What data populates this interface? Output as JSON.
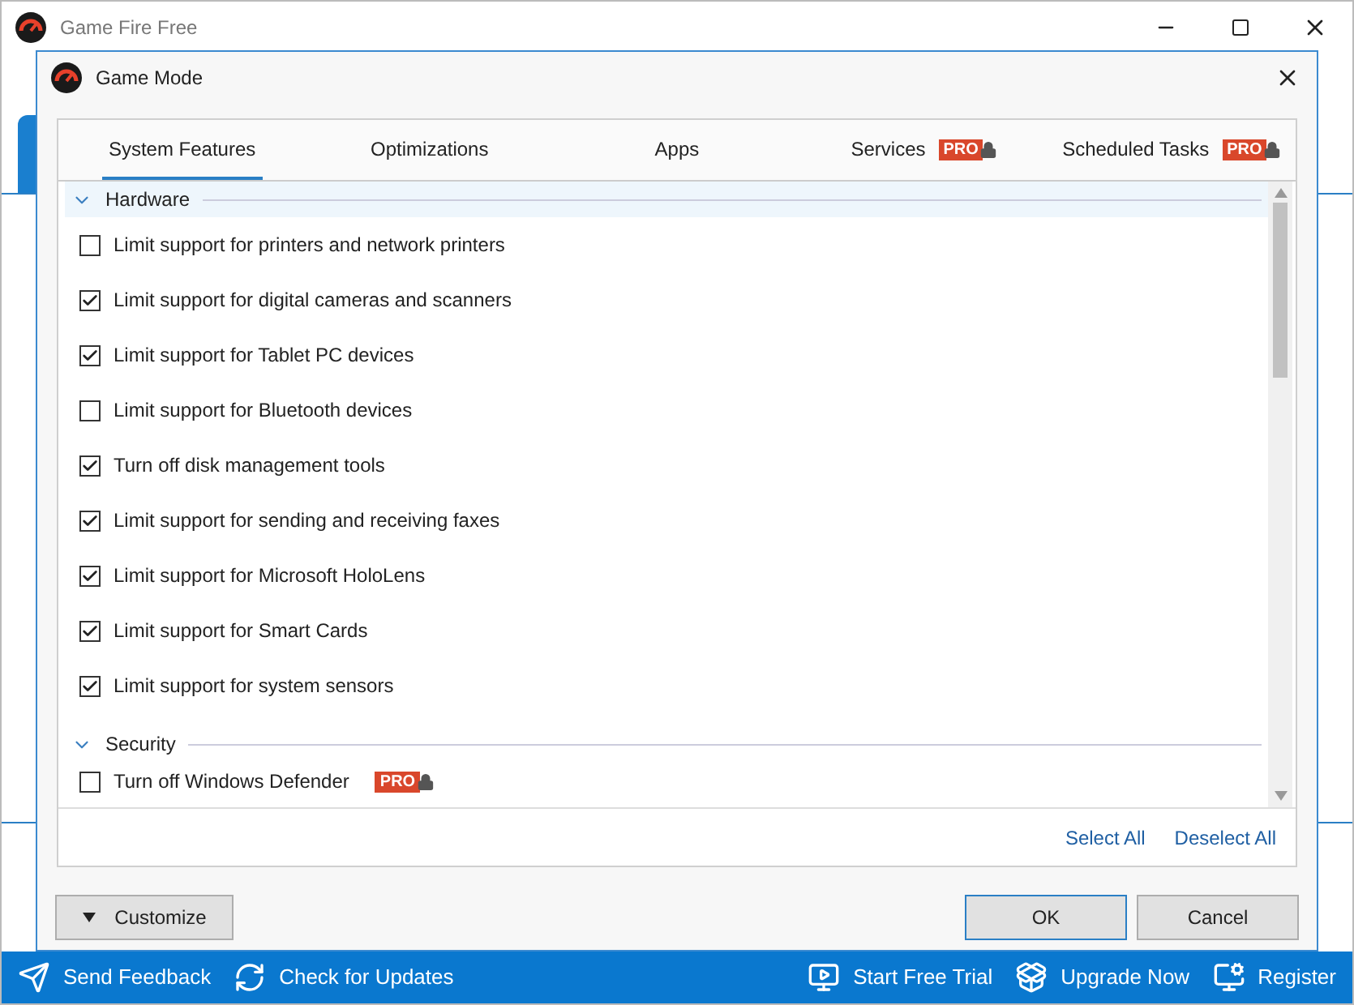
{
  "window": {
    "title": "Game Fire Free"
  },
  "dialog": {
    "title": "Game Mode"
  },
  "tabs": [
    {
      "label": "System Features",
      "selected": true
    },
    {
      "label": "Optimizations",
      "selected": false
    },
    {
      "label": "Apps",
      "selected": false
    },
    {
      "label": "Services",
      "selected": false,
      "badge": "PRO"
    },
    {
      "label": "Scheduled Tasks",
      "selected": false,
      "badge": "PRO"
    }
  ],
  "groups": [
    {
      "title": "Hardware",
      "expanded": true,
      "highlighted": true,
      "items": [
        {
          "label": "Limit support for printers and network printers",
          "checked": false
        },
        {
          "label": "Limit support for digital cameras and scanners",
          "checked": true
        },
        {
          "label": "Limit support for Tablet PC devices",
          "checked": true
        },
        {
          "label": "Limit support for Bluetooth devices",
          "checked": false
        },
        {
          "label": "Turn off disk management tools",
          "checked": true
        },
        {
          "label": "Limit support for sending and receiving faxes",
          "checked": true
        },
        {
          "label": "Limit support for Microsoft HoloLens",
          "checked": true
        },
        {
          "label": "Limit support for Smart Cards",
          "checked": true
        },
        {
          "label": "Limit support for system sensors",
          "checked": true
        }
      ]
    },
    {
      "title": "Security",
      "expanded": true,
      "highlighted": false,
      "items": [
        {
          "label": "Turn off Windows Defender",
          "checked": false,
          "badge": "PRO"
        }
      ]
    }
  ],
  "links": [
    "Select All",
    "Deselect All"
  ],
  "customize_button": "Customize",
  "buttons": [
    {
      "label": "OK",
      "default": true
    },
    {
      "label": "Cancel",
      "default": false
    }
  ],
  "status_bar": {
    "left": [
      {
        "label": "Send Feedback"
      },
      {
        "label": "Check for Updates"
      }
    ],
    "right": [
      {
        "label": "Start Free Trial"
      },
      {
        "label": "Upgrade Now"
      },
      {
        "label": "Register"
      }
    ]
  }
}
